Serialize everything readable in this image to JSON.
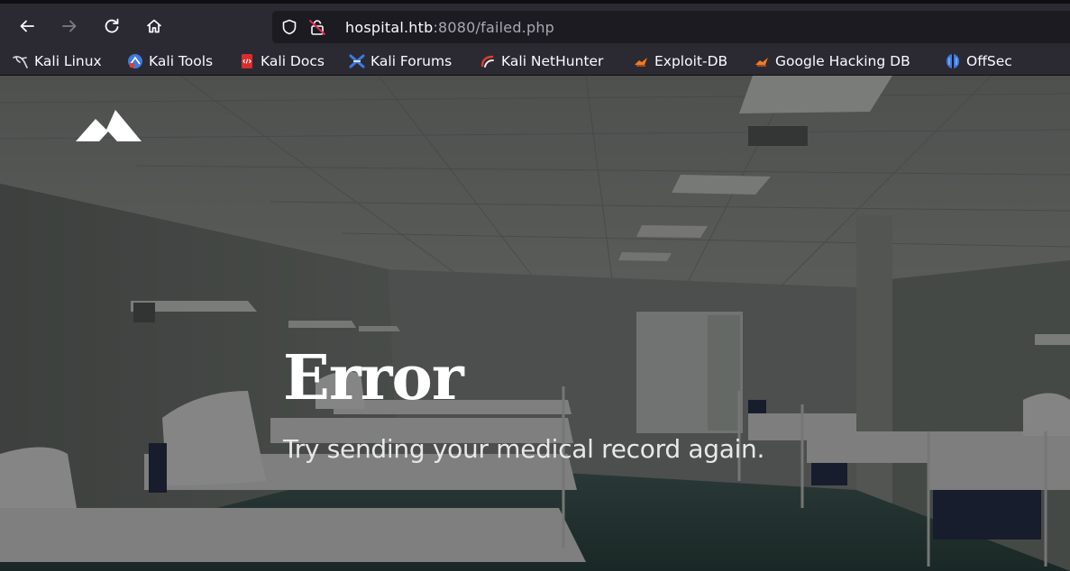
{
  "browser": {
    "url_host": "hospital.htb",
    "url_rest": ":8080/failed.php"
  },
  "bookmarks": [
    {
      "label": "Kali Linux",
      "icon": "kali-dragon-icon"
    },
    {
      "label": "Kali Tools",
      "icon": "kali-tools-icon"
    },
    {
      "label": "Kali Docs",
      "icon": "kali-docs-icon"
    },
    {
      "label": "Kali Forums",
      "icon": "kali-forums-icon"
    },
    {
      "label": "Kali NetHunter",
      "icon": "kali-nethunter-icon"
    },
    {
      "label": "Exploit-DB",
      "icon": "exploit-db-icon"
    },
    {
      "label": "Google Hacking DB",
      "icon": "google-hacking-db-icon"
    },
    {
      "label": "OffSec",
      "icon": "offsec-icon"
    }
  ],
  "page": {
    "title": "Error",
    "message": "Try sending your medical record again."
  },
  "colors": {
    "toolbar": "#2b2a33",
    "urlbar": "#1c1b22",
    "text": "#fbfbfe",
    "url_muted": "#a8a8b3"
  }
}
